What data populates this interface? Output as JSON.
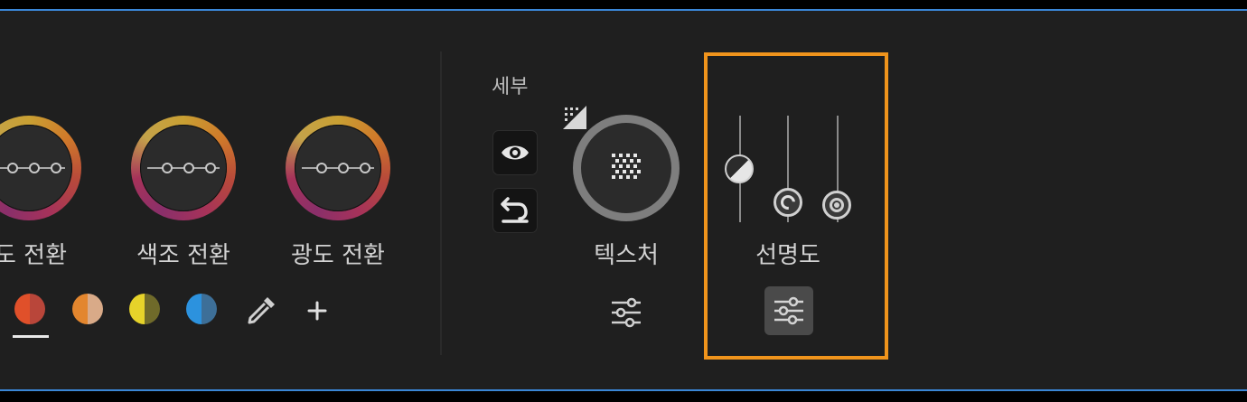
{
  "wheels": [
    {
      "label": "도 전환"
    },
    {
      "label": "색조 전환"
    },
    {
      "label": "광도 전환"
    }
  ],
  "swatches": [
    {
      "name": "red",
      "left": "#e0502a",
      "right": "#b9463a",
      "selected": true
    },
    {
      "name": "orange",
      "left": "#e3862e",
      "right": "#d9aa88"
    },
    {
      "name": "yellow",
      "left": "#e6d32a",
      "right": "#6f6a2a"
    },
    {
      "name": "blue",
      "left": "#2c92de",
      "right": "#3d6f98"
    }
  ],
  "tools": {
    "eyedropper_icon": "eyedropper-icon",
    "add_icon": "plus-icon"
  },
  "detail": {
    "section_label": "세부",
    "texture_label": "텍스처",
    "sharpness_label": "선명도"
  },
  "colors": {
    "accent_highlight": "#f0941c",
    "frame_border": "#3a86d6",
    "panel_bg": "#1f1f1f"
  }
}
